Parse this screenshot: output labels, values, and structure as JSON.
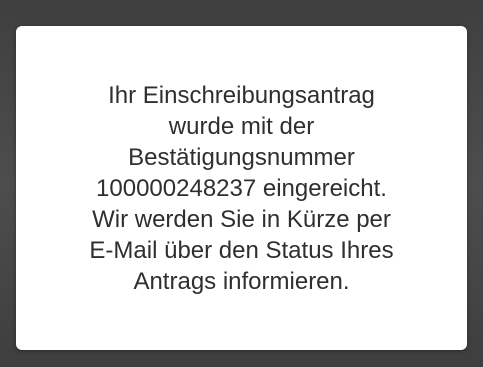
{
  "dialog": {
    "message_lines": [
      "Ihr Einschreibungsantrag",
      "wurde mit der",
      "Bestätigungsnummer",
      "100000248237 eingereicht.",
      "Wir werden Sie in Kürze per",
      "E-Mail über den Status Ihres",
      "Antrags informieren."
    ]
  },
  "colors": {
    "backdrop": "#4b4b4b",
    "dialog_background": "#ffffff",
    "text": "#2f2f2f"
  }
}
